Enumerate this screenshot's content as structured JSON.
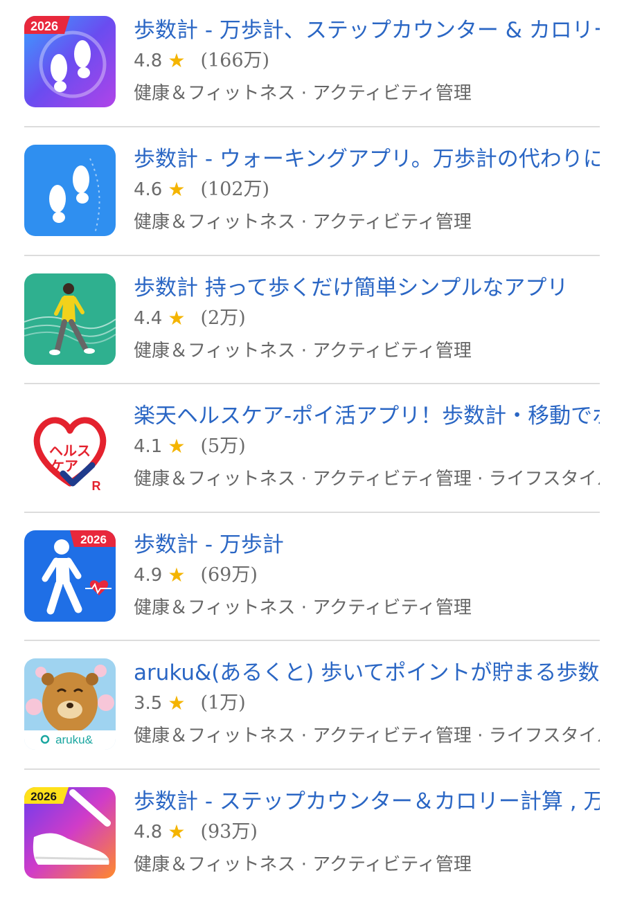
{
  "apps": [
    {
      "title": "歩数計 - 万歩計、ステップカウンター & カロリー計",
      "rating": "4.8",
      "reviews": "(166万)",
      "categories": "健康＆フィットネス · アクティビティ管理",
      "badge": "2026"
    },
    {
      "title": "歩数計 - ウォーキングアプリ。万歩計の代わりに使",
      "rating": "4.6",
      "reviews": "(102万)",
      "categories": "健康＆フィットネス · アクティビティ管理"
    },
    {
      "title": "歩数計 持って歩くだけ簡単シンプルなアプリ",
      "rating": "4.4",
      "reviews": "(2万)",
      "categories": "健康＆フィットネス · アクティビティ管理"
    },
    {
      "title": "楽天ヘルスケア-ポイ活アプリ！歩数計・移動でポイ",
      "rating": "4.1",
      "reviews": "(5万)",
      "categories": "健康＆フィットネス · アクティビティ管理 · ライフスタイル",
      "logo_text_1": "ヘルス",
      "logo_text_2": "ケア",
      "logo_mark": "R"
    },
    {
      "title": "歩数計 - 万歩計",
      "rating": "4.9",
      "reviews": "(69万)",
      "categories": "健康＆フィットネス · アクティビティ管理",
      "badge": "2026"
    },
    {
      "title": "aruku&(あるくと) 歩いてポイントが貯まる歩数計",
      "rating": "3.5",
      "reviews": "(1万)",
      "categories": "健康＆フィットネス · アクティビティ管理 · ライフスタイル",
      "logo_text": "aruku&"
    },
    {
      "title": "歩数計 - ステップカウンター＆カロリー計算 , 万歩",
      "rating": "4.8",
      "reviews": "(93万)",
      "categories": "健康＆フィットネス · アクティビティ管理",
      "badge": "2026"
    }
  ],
  "star_glyph": "★",
  "colors": {
    "title": "#2a66c4",
    "star": "#f4b400",
    "meta": "#6b6b6b",
    "divider": "#dcdcdc"
  }
}
